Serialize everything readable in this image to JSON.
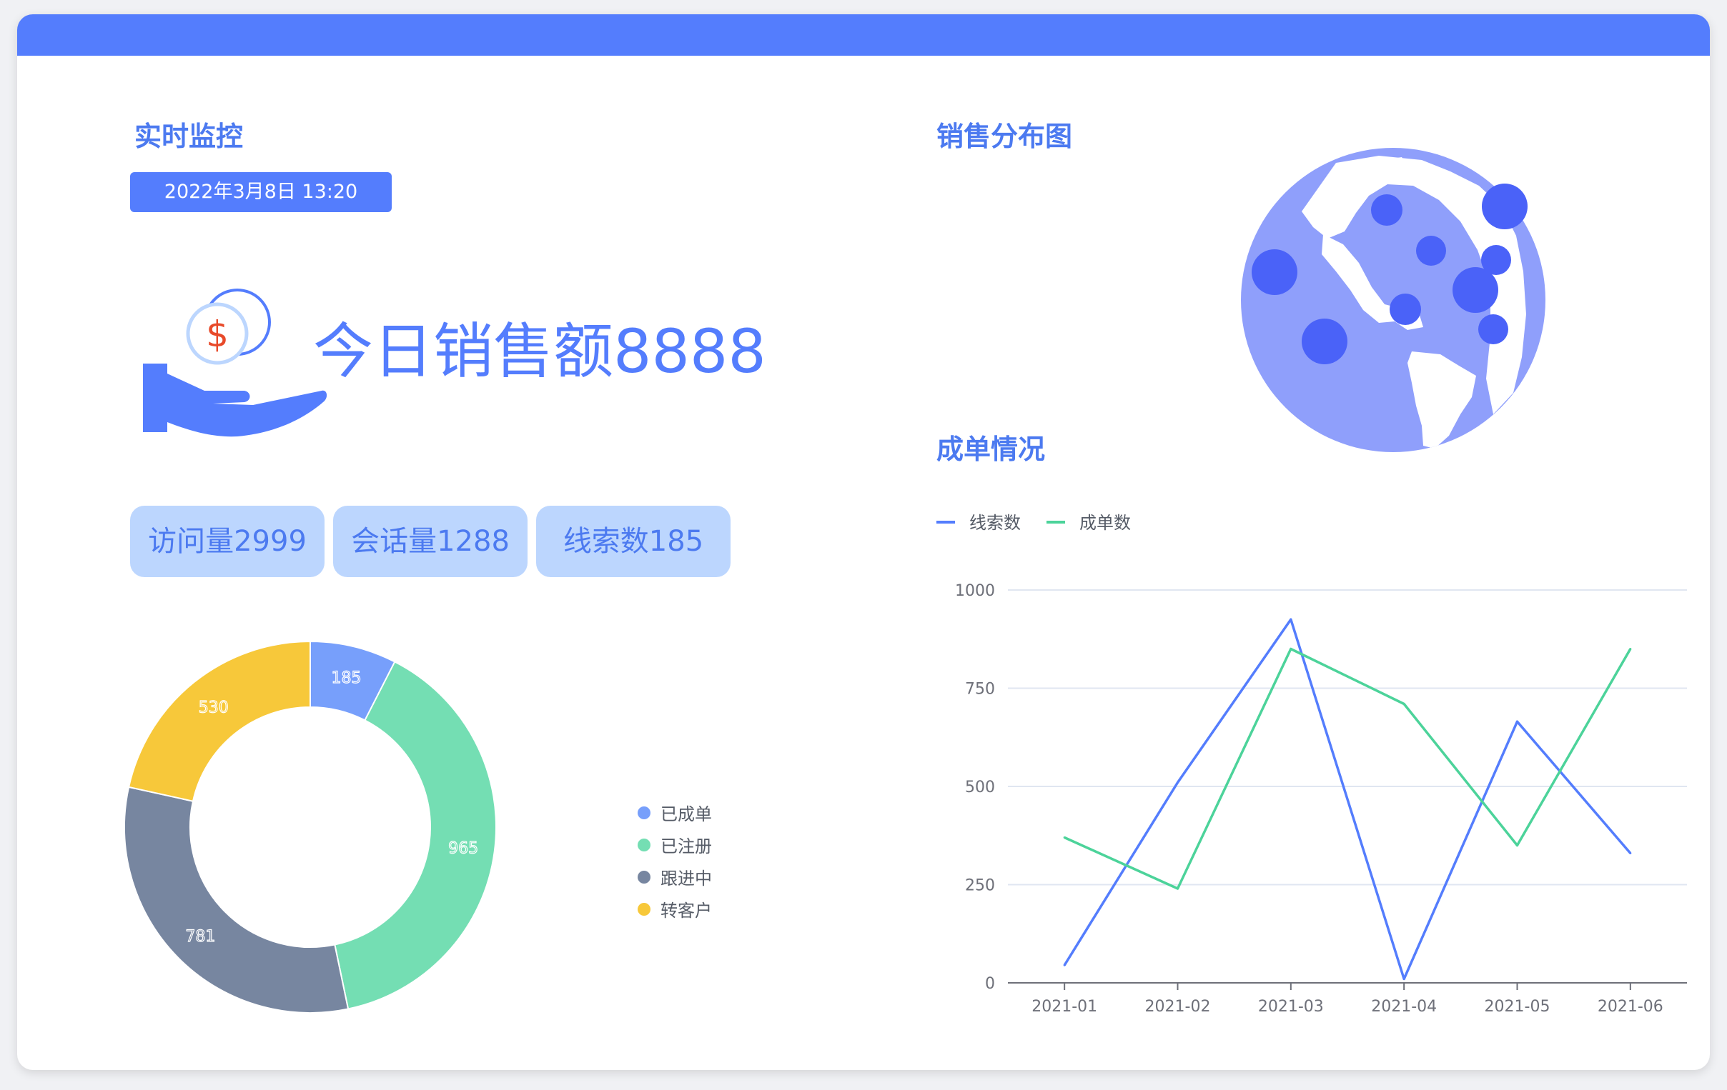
{
  "monitor": {
    "title": "实时监控",
    "datetime": "2022年3月8日  13:20",
    "sales_label": "今日销售额8888",
    "stats": [
      "访问量2999",
      "会话量1288",
      "线索数185"
    ]
  },
  "distribution": {
    "title": "销售分布图"
  },
  "deals": {
    "title": "成单情况"
  },
  "colors": {
    "brand": "#547dfd",
    "globe": "#8f9ffb",
    "bubble": "#4a62f8",
    "pill": "#bcd6fe"
  },
  "icons": {
    "hand": "hand-coin-icon",
    "globe": "globe-icon"
  },
  "chart_data": [
    {
      "type": "pie",
      "variant": "donut",
      "categories": [
        "已成单",
        "已注册",
        "跟进中",
        "转客户"
      ],
      "values": [
        185,
        965,
        781,
        530
      ],
      "colors": [
        "#779ffb",
        "#74deb3",
        "#7786a0",
        "#f7c83a"
      ],
      "legend_position": "right"
    },
    {
      "type": "line",
      "categories": [
        "2021-01",
        "2021-02",
        "2021-03",
        "2021-04",
        "2021-05",
        "2021-06"
      ],
      "series": [
        {
          "name": "线索数",
          "color": "#547dfd",
          "values": [
            45,
            510,
            925,
            10,
            665,
            330
          ]
        },
        {
          "name": "成单数",
          "color": "#4cd39a",
          "values": [
            370,
            240,
            850,
            710,
            350,
            850
          ]
        }
      ],
      "yticks": [
        "0",
        "250",
        "500",
        "750",
        "1000"
      ],
      "ylim": [
        0,
        1000
      ],
      "grid": true,
      "legend_position": "top-left"
    }
  ]
}
